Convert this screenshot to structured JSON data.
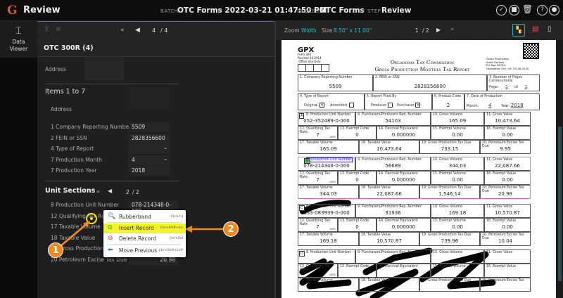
{
  "header": {
    "logo": "G",
    "title": "Review",
    "batch_label": "BATCH",
    "batch": "OTC Forms 2022-03-21 01:47:50 PM",
    "process_label": "PROCESS",
    "process": "OTC Forms",
    "step_label": "STEP",
    "step": "Review"
  },
  "rail": {
    "item": "Data Viewer"
  },
  "left": {
    "pager": {
      "current": "4",
      "total": "/ 4"
    },
    "doc_title": "OTC 300R (4)",
    "address_label": "Address",
    "items_title": "Items 1 to 7",
    "items_address_label": "Address",
    "fields": [
      {
        "label": "1 Company Reporting Number",
        "value": "5509"
      },
      {
        "label": "2 FEIN or SSN",
        "value": "2828356600"
      },
      {
        "label": "4 Type of Report",
        "value": "",
        "select": true
      },
      {
        "label": "7 Production Month",
        "value": "4",
        "select": true
      },
      {
        "label": "7 Production Year",
        "value": "2018"
      }
    ],
    "unit_title": "Unit Sections",
    "unit_pager": {
      "current": "2",
      "total": "/ 2"
    },
    "unit_fields": [
      {
        "label": "8 Production Unit Number",
        "value": "078-214348-0-000"
      },
      {
        "label": "12 Qualifying Tax Rate",
        "value": ""
      },
      {
        "label": "17 Taxable Volume",
        "value": ""
      },
      {
        "label": "18 Taxable Value",
        "value": ""
      },
      {
        "label": "19 Gross Production Tax Due",
        "value": ""
      },
      {
        "label": "20 Petroleum Excise Tax Due",
        "value": "20.98"
      }
    ]
  },
  "menu": [
    {
      "label": "Rubberband",
      "shortcut": "Ctrl+Fd",
      "icon": "rubberband-icon"
    },
    {
      "label": "Insert Record",
      "shortcut": "Ctrl+Shift+Ins",
      "icon": "insert-record-icon",
      "highlight": true
    },
    {
      "label": "Delete Record",
      "shortcut": "Ctrl+Del",
      "icon": "delete-record-icon"
    },
    {
      "label": "Move Previous",
      "shortcut": "Ctrl+Shift+Left",
      "icon": "arrow-left-icon"
    }
  ],
  "callouts": [
    "1",
    "2"
  ],
  "viewer": {
    "zoom_label": "Zoom",
    "zoom": "Width",
    "size_label": "Size",
    "size": "8.50\" x 11.00\"",
    "page": "1",
    "pages": "/ 2"
  },
  "form": {
    "gpx": "GPX",
    "form_no": "Form 300",
    "revised": "Revised 10-2014",
    "office": "-Office Use Only-",
    "title1": "Oklahoma Tax Commission",
    "title2": "Gross Production Monthly Tax Report",
    "address": [
      "Gross Production",
      "Audit Section",
      "PO Box 26740",
      "Oklahoma City, OK 73126-0740"
    ],
    "f1_label": "1. Company Reporting Number",
    "f1": "5509",
    "f2_label": "2. FEIN or SSN",
    "f2": "2828356600",
    "f3_label": "3. Number of Pages Consecutively",
    "page_label": "Page:",
    "page": "1",
    "of_label": "of",
    "of": "1",
    "f4_label": "4. Type of Report",
    "original": "Original",
    "amended": "Amended",
    "f5_label": "5. Report Filed By",
    "producer": "Producer",
    "purchaser": "Purchaser",
    "f6_label": "6. Product Code",
    "f6": "2",
    "f7_label": "7. Date of Production",
    "month_label": "Month:",
    "month": "4",
    "year_label": "Year:",
    "year": "2018",
    "col_labels": [
      "8. Production Unit Number",
      "9. Purchasers/Producers Rep. Number",
      "10. Gross Volume",
      "11. Gross Value",
      "12. Qualifying Tax Rate",
      "13. Exempt Code",
      "14. Decimal Equivalent",
      "15. Exempt Volume",
      "16. Exempt Value",
      "17. Taxable Volume",
      "18. Taxable Value",
      "19. Gross Production Tax Due",
      "20. Petroleum Excise Tax Due"
    ],
    "pct": ".00%",
    "sections": [
      {
        "letter": "A",
        "values": [
          "052-352489-0-000",
          "54103",
          "165.09",
          "10,473.64",
          "7",
          "0",
          "0.000000",
          "0.00",
          "0.00",
          "165.09",
          "10,473.64",
          "733.15",
          "9.95"
        ]
      },
      {
        "letter": "B",
        "values": [
          "078-214348-0-000",
          "56689",
          "344.03",
          "22,087.66",
          "7",
          "0",
          "0.000000",
          "0.00",
          "0.00",
          "344.03",
          "22,087.66",
          "1,546.14",
          "20.98"
        ],
        "active": true
      },
      {
        "letter": "C",
        "values": [
          "033-083939-0-000",
          "31936",
          "169.18",
          "10,570.87",
          "7",
          "0",
          "0.000000",
          "0.00",
          "0.00",
          "169.18",
          "10,570.87",
          "739.96",
          "10.04"
        ]
      },
      {
        "letter": "D",
        "values": [
          "",
          "",
          "",
          "",
          "",
          "",
          "",
          "",
          "",
          "",
          "",
          "",
          ""
        ]
      }
    ]
  }
}
